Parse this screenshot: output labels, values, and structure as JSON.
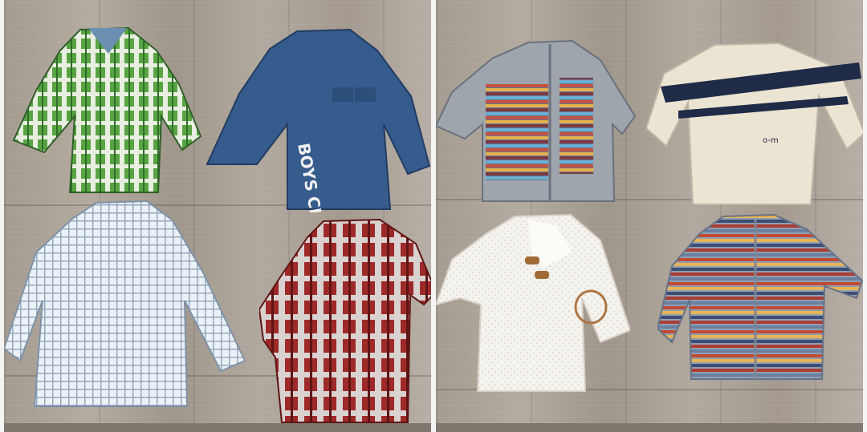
{
  "photo": {
    "panels": [
      {
        "name": "left",
        "items": [
          {
            "name": "green-plaid-shirt",
            "color": "#4f9a3f"
          },
          {
            "name": "denim-shirt",
            "color": "#3a5f93",
            "print": "BOYS CLUB"
          },
          {
            "name": "blue-check-shirt",
            "color": "#dfe7ee"
          },
          {
            "name": "red-plaid-shirt",
            "color": "#9b2b2b"
          }
        ]
      },
      {
        "name": "right",
        "items": [
          {
            "name": "grey-striped-zip-cardigan",
            "color": "#9ea5ad"
          },
          {
            "name": "cream-sweater",
            "color": "#ece6d4",
            "print": "o-m"
          },
          {
            "name": "white-knit-shawl-collar-sweater",
            "color": "#f2f0ea"
          },
          {
            "name": "multicolor-striped-zip-cardigan",
            "color": "#8f97a5"
          }
        ]
      }
    ]
  }
}
